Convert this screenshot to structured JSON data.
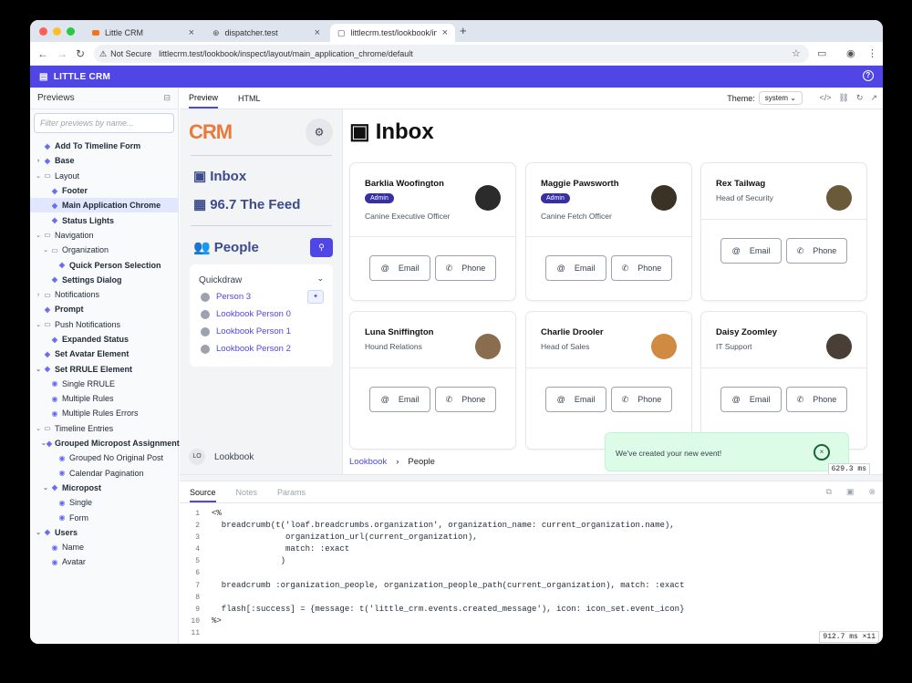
{
  "browser": {
    "tabs": [
      {
        "title": "Little CRM"
      },
      {
        "title": "dispatcher.test"
      },
      {
        "title": "littlecrm.test/lookbook/inspec"
      }
    ],
    "not_secure": "Not Secure",
    "url": "littlecrm.test/lookbook/inspect/layout/main_application_chrome/default"
  },
  "app": {
    "title": "LITTLE CRM"
  },
  "sidebar": {
    "title": "Previews",
    "filter_placeholder": "Filter previews by name...",
    "items": [
      {
        "label": "Add To Timeline Form",
        "level": 0,
        "type": "component",
        "caret": ""
      },
      {
        "label": "Base",
        "level": 0,
        "type": "component",
        "caret": "right"
      },
      {
        "label": "Layout",
        "level": 0,
        "type": "folder",
        "caret": "down"
      },
      {
        "label": "Footer",
        "level": 1,
        "type": "component",
        "caret": ""
      },
      {
        "label": "Main Application Chrome",
        "level": 1,
        "type": "component",
        "caret": "",
        "selected": true
      },
      {
        "label": "Status Lights",
        "level": 1,
        "type": "component",
        "caret": ""
      },
      {
        "label": "Navigation",
        "level": 0,
        "type": "folder",
        "caret": "down"
      },
      {
        "label": "Organization",
        "level": 1,
        "type": "folder",
        "caret": "down"
      },
      {
        "label": "Quick Person Selection",
        "level": 2,
        "type": "component",
        "caret": ""
      },
      {
        "label": "Settings Dialog",
        "level": 1,
        "type": "component",
        "caret": ""
      },
      {
        "label": "Notifications",
        "level": 0,
        "type": "folder",
        "caret": "right"
      },
      {
        "label": "Prompt",
        "level": 0,
        "type": "component",
        "caret": ""
      },
      {
        "label": "Push Notifications",
        "level": 0,
        "type": "folder",
        "caret": "down"
      },
      {
        "label": "Expanded Status",
        "level": 1,
        "type": "component",
        "caret": ""
      },
      {
        "label": "Set Avatar Element",
        "level": 0,
        "type": "component",
        "caret": ""
      },
      {
        "label": "Set RRULE Element",
        "level": 0,
        "type": "component",
        "caret": "down"
      },
      {
        "label": "Single RRULE",
        "level": 1,
        "type": "eye",
        "caret": ""
      },
      {
        "label": "Multiple Rules",
        "level": 1,
        "type": "eye",
        "caret": ""
      },
      {
        "label": "Multiple Rules Errors",
        "level": 1,
        "type": "eye",
        "caret": ""
      },
      {
        "label": "Timeline Entries",
        "level": 0,
        "type": "folder",
        "caret": "down"
      },
      {
        "label": "Grouped Micropost Assignment",
        "level": 1,
        "type": "component",
        "caret": "down"
      },
      {
        "label": "Grouped No Original Post",
        "level": 2,
        "type": "eye",
        "caret": ""
      },
      {
        "label": "Calendar Pagination",
        "level": 2,
        "type": "eye",
        "caret": ""
      },
      {
        "label": "Micropost",
        "level": 1,
        "type": "component",
        "caret": "down"
      },
      {
        "label": "Single",
        "level": 2,
        "type": "eye",
        "caret": ""
      },
      {
        "label": "Form",
        "level": 2,
        "type": "eye",
        "caret": ""
      },
      {
        "label": "Users",
        "level": 0,
        "type": "component",
        "caret": "down"
      },
      {
        "label": "Name",
        "level": 1,
        "type": "eye",
        "caret": ""
      },
      {
        "label": "Avatar",
        "level": 1,
        "type": "eye",
        "caret": ""
      }
    ]
  },
  "main": {
    "tabs": [
      "Preview",
      "HTML"
    ],
    "theme_label": "Theme:",
    "theme_value": "system"
  },
  "preview": {
    "logo": "CRM",
    "nav": {
      "inbox": "Inbox",
      "feed": "96.7 The Feed",
      "people": "People"
    },
    "quickdraw": {
      "title": "Quickdraw",
      "people": [
        "Person 3",
        "Lookbook Person 0",
        "Lookbook Person 1",
        "Lookbook Person 2"
      ]
    },
    "lookbook_badge": "LO",
    "lookbook_label": "Lookbook",
    "inbox_title": "Inbox",
    "cards": [
      {
        "name": "Barklia Woofington",
        "badge": "Admin",
        "role": "Canine Executive Officer",
        "photo_color": "#2b2b2b"
      },
      {
        "name": "Maggie Pawsworth",
        "badge": "Admin",
        "role": "Canine Fetch Officer",
        "photo_color": "#3a3224"
      },
      {
        "name": "Rex Tailwag",
        "badge": "",
        "role": "Head of Security",
        "photo_color": "#6b5a3a"
      },
      {
        "name": "Luna Sniffington",
        "badge": "",
        "role": "Hound Relations",
        "photo_color": "#8a6d4f"
      },
      {
        "name": "Charlie Drooler",
        "badge": "",
        "role": "Head of Sales",
        "photo_color": "#d08a42"
      },
      {
        "name": "Daisy Zoomley",
        "badge": "",
        "role": "IT Support",
        "photo_color": "#4a3f36"
      }
    ],
    "email_label": "Email",
    "phone_label": "Phone",
    "breadcrumbs": [
      "Lookbook",
      "People"
    ],
    "toast": "We've created your new event!",
    "timing": "629.3 ms"
  },
  "bottom": {
    "tabs": [
      "Source",
      "Notes",
      "Params"
    ],
    "timing": "912.7 ms ×11",
    "code_lines": [
      "<%",
      "  breadcrumb(t('loaf.breadcrumbs.organization', organization_name: current_organization.name),",
      "               organization_url(current_organization),",
      "               match: :exact",
      "              )",
      "",
      "  breadcrumb :organization_people, organization_people_path(current_organization), match: :exact",
      "",
      "  flash[:success] = {message: t('little_crm.events.created_message'), icon: icon_set.event_icon}",
      "%>",
      ""
    ]
  }
}
